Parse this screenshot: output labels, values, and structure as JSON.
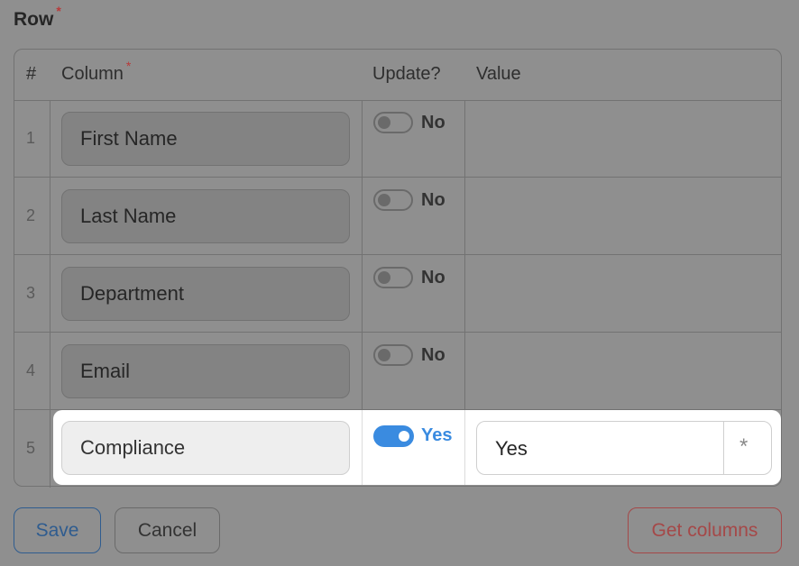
{
  "section": {
    "title": "Row",
    "required_mark": "*"
  },
  "table": {
    "headers": {
      "num": "#",
      "column": "Column",
      "column_required": "*",
      "update": "Update?",
      "value": "Value"
    },
    "rows": [
      {
        "num": "1",
        "column": "First Name",
        "update_label": "No"
      },
      {
        "num": "2",
        "column": "Last Name",
        "update_label": "No"
      },
      {
        "num": "3",
        "column": "Department",
        "update_label": "No"
      },
      {
        "num": "4",
        "column": "Email",
        "update_label": "No"
      }
    ],
    "active_row": {
      "num": "5",
      "column": "Compliance",
      "update_label": "Yes",
      "value": "Yes",
      "addon": "*"
    }
  },
  "buttons": {
    "save": "Save",
    "cancel": "Cancel",
    "get_columns": "Get columns"
  },
  "colors": {
    "accent": "#3a8be0",
    "danger": "#a54848",
    "overlay": "#8f8f8f"
  }
}
